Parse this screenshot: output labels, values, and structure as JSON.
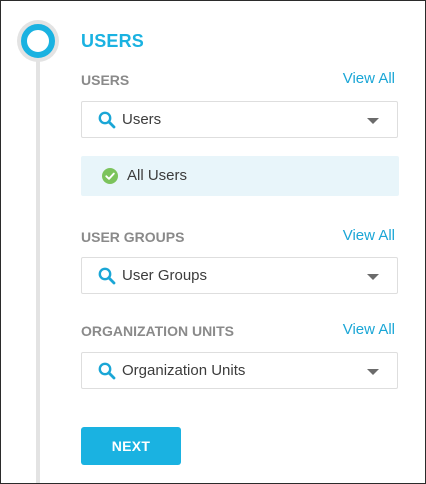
{
  "step": {
    "title": "USERS"
  },
  "sections": {
    "users": {
      "label": "USERS",
      "view_all": "View All",
      "select_placeholder": "Users",
      "selected_items": [
        "All Users"
      ]
    },
    "user_groups": {
      "label": "USER GROUPS",
      "view_all": "View All",
      "select_placeholder": "User Groups"
    },
    "organization_units": {
      "label": "ORGANIZATION UNITS",
      "view_all": "View All",
      "select_placeholder": "Organization Units"
    }
  },
  "actions": {
    "next_label": "NEXT"
  },
  "colors": {
    "accent": "#1ab2e1",
    "link": "#1aa6d6",
    "label": "#8a8a8a",
    "chip_background": "#e8f5fa",
    "success": "#7cc35c",
    "rail": "#e3e3e3"
  },
  "icons": {
    "search": "search-icon",
    "dropdown": "chevron-down-icon",
    "selected": "check-circle-icon"
  }
}
